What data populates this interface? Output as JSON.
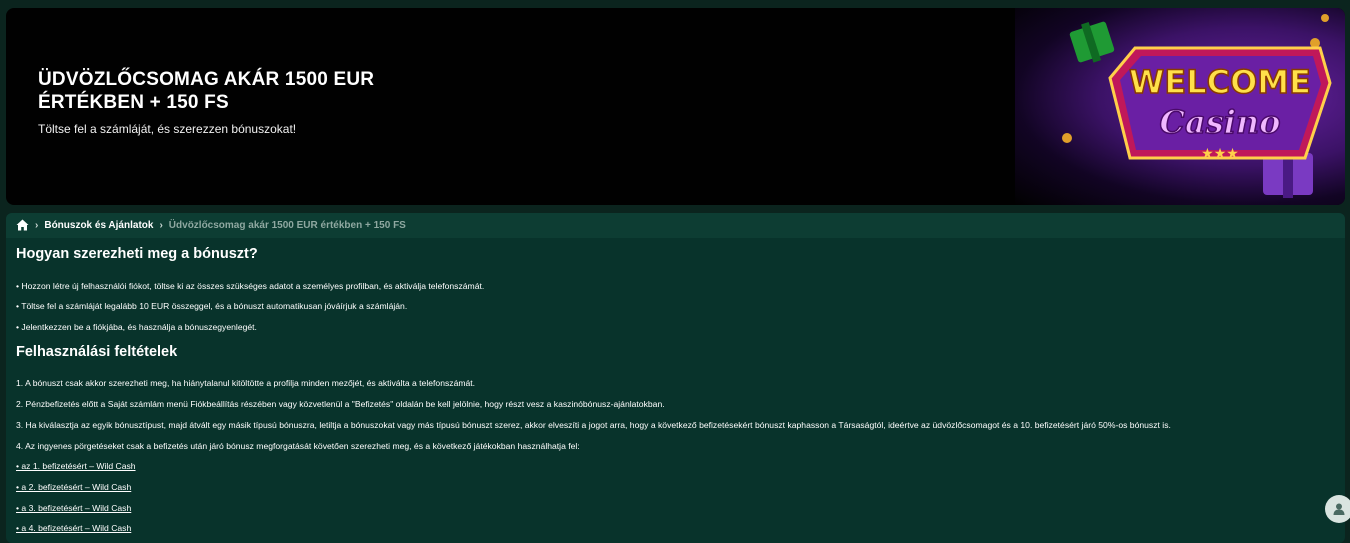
{
  "banner": {
    "title": "ÜDVÖZLŐCSOMAG AKÁR 1500 EUR ÉRTÉKBEN + 150 FS",
    "subtitle": "Töltse fel a számláját, és szerezzen bónuszokat!",
    "art_text_1": "WELCOME",
    "art_text_2": "Casino"
  },
  "breadcrumb": {
    "items": [
      "Bónuszok és Ajánlatok",
      "Üdvözlőcsomag akár 1500 EUR értékben + 150 FS"
    ]
  },
  "how": {
    "heading": "Hogyan szerezheti meg a bónuszt?",
    "bullets": [
      "• Hozzon létre új felhasználói fiókot, töltse ki az összes szükséges adatot a személyes profilban, és aktiválja telefonszámát.",
      "• Töltse fel a számláját legalább 10 EUR összeggel, és a bónuszt automatikusan jóváírjuk a számláján.",
      "• Jelentkezzen be a fiókjába, és használja a bónuszegyenlegét."
    ]
  },
  "terms": {
    "heading": "Felhasználási feltételek",
    "items": [
      "1. A bónuszt csak akkor szerezheti meg, ha hiánytalanul kitöltötte a profilja minden mezőjét, és aktiválta a telefonszámát.",
      "2. Pénzbefizetés előtt a Saját számlám menü Fiókbeállítás részében vagy közvetlenül a \"Befizetés\" oldalán be kell jelölnie, hogy részt vesz a kaszinóbónusz-ajánlatokban.",
      "3. Ha kiválasztja az egyik bónusztípust, majd átvált egy másik típusú bónuszra, letiltja a bónuszokat vagy más típusú bónuszt szerez, akkor elveszíti a jogot arra, hogy a következő befizetésekért bónuszt kaphasson a Társaságtól, ideértve az üdvözlőcsomagot és a 10. befizetésért járó 50%-os bónuszt is.",
      "4. Az ingyenes pörgetéseket csak a befizetés után járó bónusz megforgatását követően szerezheti meg, és a következő játékokban használhatja fel:"
    ],
    "links": [
      "• az 1. befizetésért – Wild Cash",
      "• a 2. befizetésért – Wild Cash",
      "• a 3. befizetésért – Wild Cash",
      "• a 4. befizetésért – Wild Cash"
    ]
  },
  "icons": {
    "home": "home-icon",
    "chevron": "chevron-right-icon",
    "chat": "chat-icon"
  }
}
